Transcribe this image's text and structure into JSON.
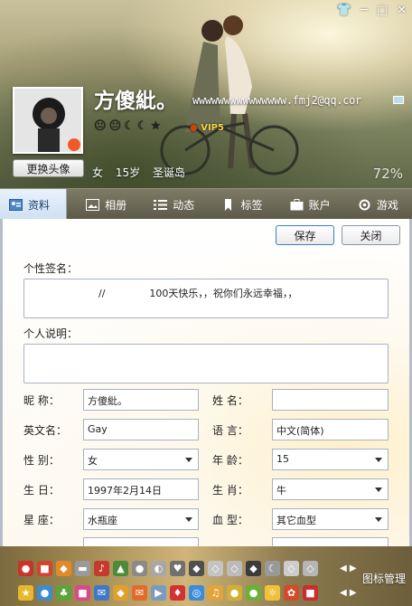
{
  "window": {
    "skin_icon": "tshirt-icon",
    "controls": [
      "─",
      "□",
      "✕"
    ]
  },
  "profile": {
    "nickname": "方傻紕。",
    "email": "wwwwwwwwwwwwwww.fmj2@qq.cor",
    "change_avatar": "更换头像",
    "level_icons": [
      "😐",
      "😐",
      "☾",
      "☾",
      "★"
    ],
    "vip": "VIP5",
    "gender": "女",
    "age_text": "15岁",
    "location": "圣诞岛",
    "completion": "72%"
  },
  "tabs": [
    {
      "label": "资料",
      "icon": "profile-card-icon"
    },
    {
      "label": "相册",
      "icon": "photo-album-icon"
    },
    {
      "label": "动态",
      "icon": "feed-list-icon"
    },
    {
      "label": "标签",
      "icon": "bookmark-icon"
    },
    {
      "label": "账户",
      "icon": "briefcase-icon"
    },
    {
      "label": "游戏",
      "icon": "game-gear-icon"
    }
  ],
  "actions": {
    "save": "保存",
    "close": "关闭"
  },
  "signature": {
    "label": "个性签名：",
    "value": "//              100天快乐，，祝你们永远幸福，，"
  },
  "description": {
    "label": "个人说明：",
    "value": ""
  },
  "fields": {
    "nickname_label": "昵    称：",
    "nickname": "方傻紕。",
    "name_label": "姓    名：",
    "name": "",
    "english_label": "英文名：",
    "english": "Gay",
    "language_label": "语    言：",
    "language": "中文(简体)",
    "gender_label": "性    别：",
    "gender": "女",
    "age_label": "年    龄：",
    "age": "15",
    "birthday_label": "生    日：",
    "birthday": "1997年2月14日",
    "zodiac_label": "生    肖：",
    "zodiac": "牛",
    "constellation_label": "星    座：",
    "constellation": "水瓶座",
    "blood_label": "血    型：",
    "blood": "其它血型"
  },
  "footer": {
    "icon_manage": "图标管理"
  },
  "colors": {
    "accent": "#3f7cc0",
    "tab_bar": "#6a6752",
    "footer": "#a08a52"
  }
}
